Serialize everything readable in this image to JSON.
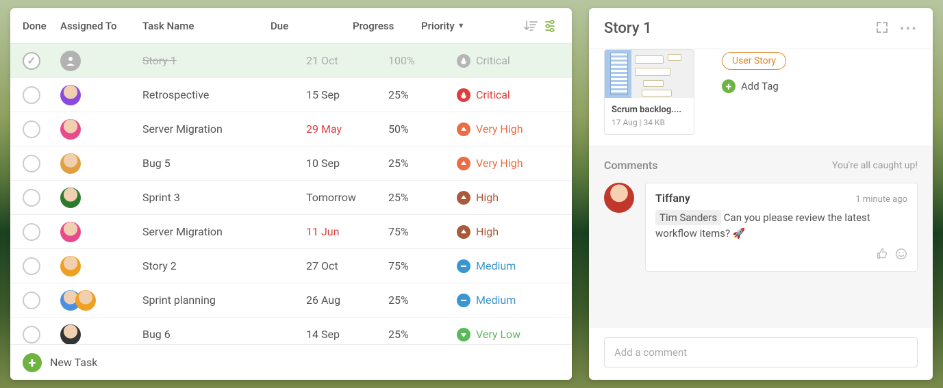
{
  "columns": {
    "done": "Done",
    "assigned": "Assigned To",
    "name": "Task Name",
    "due": "Due",
    "progress": "Progress",
    "priority": "Priority"
  },
  "tasks": [
    {
      "done": true,
      "assignees": 1,
      "avatar_placeholder": true,
      "name": "Story 1",
      "due": "21 Oct",
      "overdue": false,
      "progress": "100%",
      "priority": "Critical",
      "priority_key": "critical"
    },
    {
      "done": false,
      "assignees": 1,
      "avatar_bg": "#8a4adf",
      "name": "Retrospective",
      "due": "15 Sep",
      "overdue": false,
      "progress": "25%",
      "priority": "Critical",
      "priority_key": "critical"
    },
    {
      "done": false,
      "assignees": 1,
      "avatar_bg": "#e84a8c",
      "name": "Server Migration",
      "due": "29 May",
      "overdue": true,
      "progress": "50%",
      "priority": "Very High",
      "priority_key": "veryhigh"
    },
    {
      "done": false,
      "assignees": 1,
      "avatar_bg": "#e0a040",
      "name": "Bug 5",
      "due": "10 Sep",
      "overdue": false,
      "progress": "25%",
      "priority": "Very High",
      "priority_key": "veryhigh"
    },
    {
      "done": false,
      "assignees": 1,
      "avatar_bg": "#2e7a2e",
      "name": "Sprint 3",
      "due": "Tomorrow",
      "overdue": false,
      "progress": "25%",
      "priority": "High",
      "priority_key": "high"
    },
    {
      "done": false,
      "assignees": 1,
      "avatar_bg": "#e84a8c",
      "name": "Server Migration",
      "due": "11 Jun",
      "overdue": true,
      "progress": "75%",
      "priority": "High",
      "priority_key": "high"
    },
    {
      "done": false,
      "assignees": 1,
      "avatar_bg": "#f0a020",
      "name": "Story 2",
      "due": "27 Oct",
      "overdue": false,
      "progress": "75%",
      "priority": "Medium",
      "priority_key": "medium"
    },
    {
      "done": false,
      "assignees": 2,
      "avatar_bg": "#4a90e2",
      "avatar_bg2": "#f0a020",
      "name": "Sprint planning",
      "due": "26 Aug",
      "overdue": false,
      "progress": "25%",
      "priority": "Medium",
      "priority_key": "medium"
    },
    {
      "done": false,
      "assignees": 1,
      "avatar_bg": "#333",
      "name": "Bug 6",
      "due": "14 Sep",
      "overdue": false,
      "progress": "25%",
      "priority": "Very Low",
      "priority_key": "verylow"
    }
  ],
  "footer": {
    "new_task": "New Task"
  },
  "detail": {
    "title": "Story 1",
    "attachment": {
      "name": "Scrum backlog....",
      "meta": "17 Aug | 34 KB"
    },
    "tag": "User Story",
    "add_tag": "Add Tag",
    "comments_label": "Comments",
    "caught_up": "You're all caught up!",
    "comment": {
      "author": "Tiffany",
      "time": "1 minute ago",
      "mention": "Tim Sanders",
      "body": "Can you please review the latest workflow items? 🚀"
    },
    "comment_placeholder": "Add a comment"
  }
}
